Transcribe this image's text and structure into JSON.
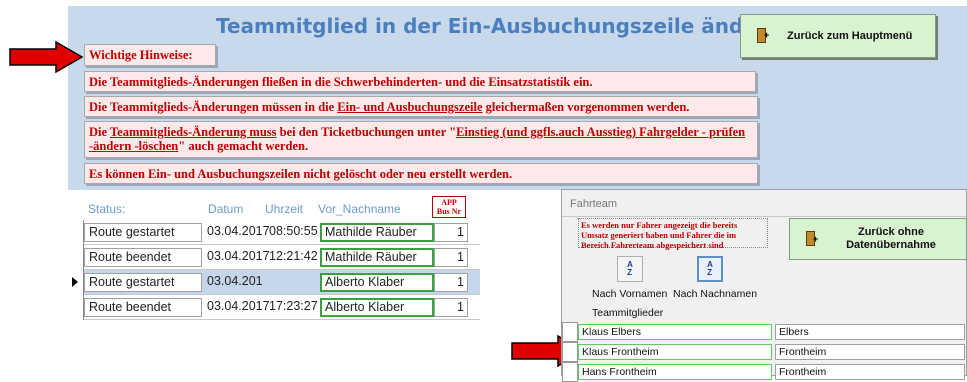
{
  "title": "Teammitglied in der Ein-Ausbuchungszeile ändern",
  "back_button": {
    "label": "Zurück zum Hauptmenü"
  },
  "notes": {
    "header": "Wichtige Hinweise:",
    "n1": "Die Teammitglieds-Änderungen fließen in die Schwerbehinderten- und die Einsatzstatistik ein.",
    "n2_pre": "Die Teammitglieds-Änderungen müssen in die ",
    "n2_u": "Ein- und Ausbuchungszeile",
    "n2_post": " gleichermaßen vorgenommen werden.",
    "n3_pre": "Die ",
    "n3_u1": "Teammitglieds-Änderung muss",
    "n3_mid": " bei den Ticketbuchungen unter \"",
    "n3_u2": "Einstieg (und ggfls.auch Ausstieg) Fahrgelder - prüfen -ändern -löschen",
    "n3_post": "\" auch gemacht werden.",
    "n4": "Es können Ein- und Ausbuchungszeilen nicht gelöscht oder neu erstellt werden."
  },
  "table": {
    "headers": {
      "status": "Status:",
      "datum": "Datum",
      "uhrzeit": "Uhrzeit",
      "name": "Vor_Nachname",
      "app_line1": "APP",
      "app_line2": "Bus Nr"
    },
    "rows": [
      {
        "status": "Route gestartet",
        "datum": "03.04.2017",
        "uhrzeit": "08:50:55",
        "name": "Mathilde Räuber",
        "bus": "1"
      },
      {
        "status": "Route beendet",
        "datum": "03.04.2017",
        "uhrzeit": "12:21:42",
        "name": "Mathilde Räuber",
        "bus": "1"
      },
      {
        "status": "Route gestartet",
        "datum": "03.04.201",
        "uhrzeit": "",
        "name": "Alberto Klaber",
        "bus": "1"
      },
      {
        "status": "Route beendet",
        "datum": "03.04.2017",
        "uhrzeit": "17:23:27",
        "name": "Alberto Klaber",
        "bus": "1"
      }
    ]
  },
  "popup": {
    "title": "Fahrteam",
    "note": "Es werden nur Fahrer angezeigt die bereits Umsatz generiert haben und Fahrer die im Bereich Fahrerteam abgespeichert sind",
    "back_button": {
      "label": "Zurück ohne Datenübernahme"
    },
    "sort_vorname_label": "Nach Vornamen",
    "sort_nachname_label": "Nach Nachnamen",
    "list_label": "Teammitglieder",
    "members": [
      {
        "full": "Klaus Elbers",
        "last": "Elbers"
      },
      {
        "full": "Klaus Frontheim",
        "last": "Frontheim"
      },
      {
        "full": "Hans Frontheim",
        "last": "Frontheim"
      }
    ]
  },
  "colors": {
    "accent": "#4a7fc0",
    "note_text": "#c00000",
    "arrow": "#e00000",
    "button_green": "#d8f3d0"
  }
}
